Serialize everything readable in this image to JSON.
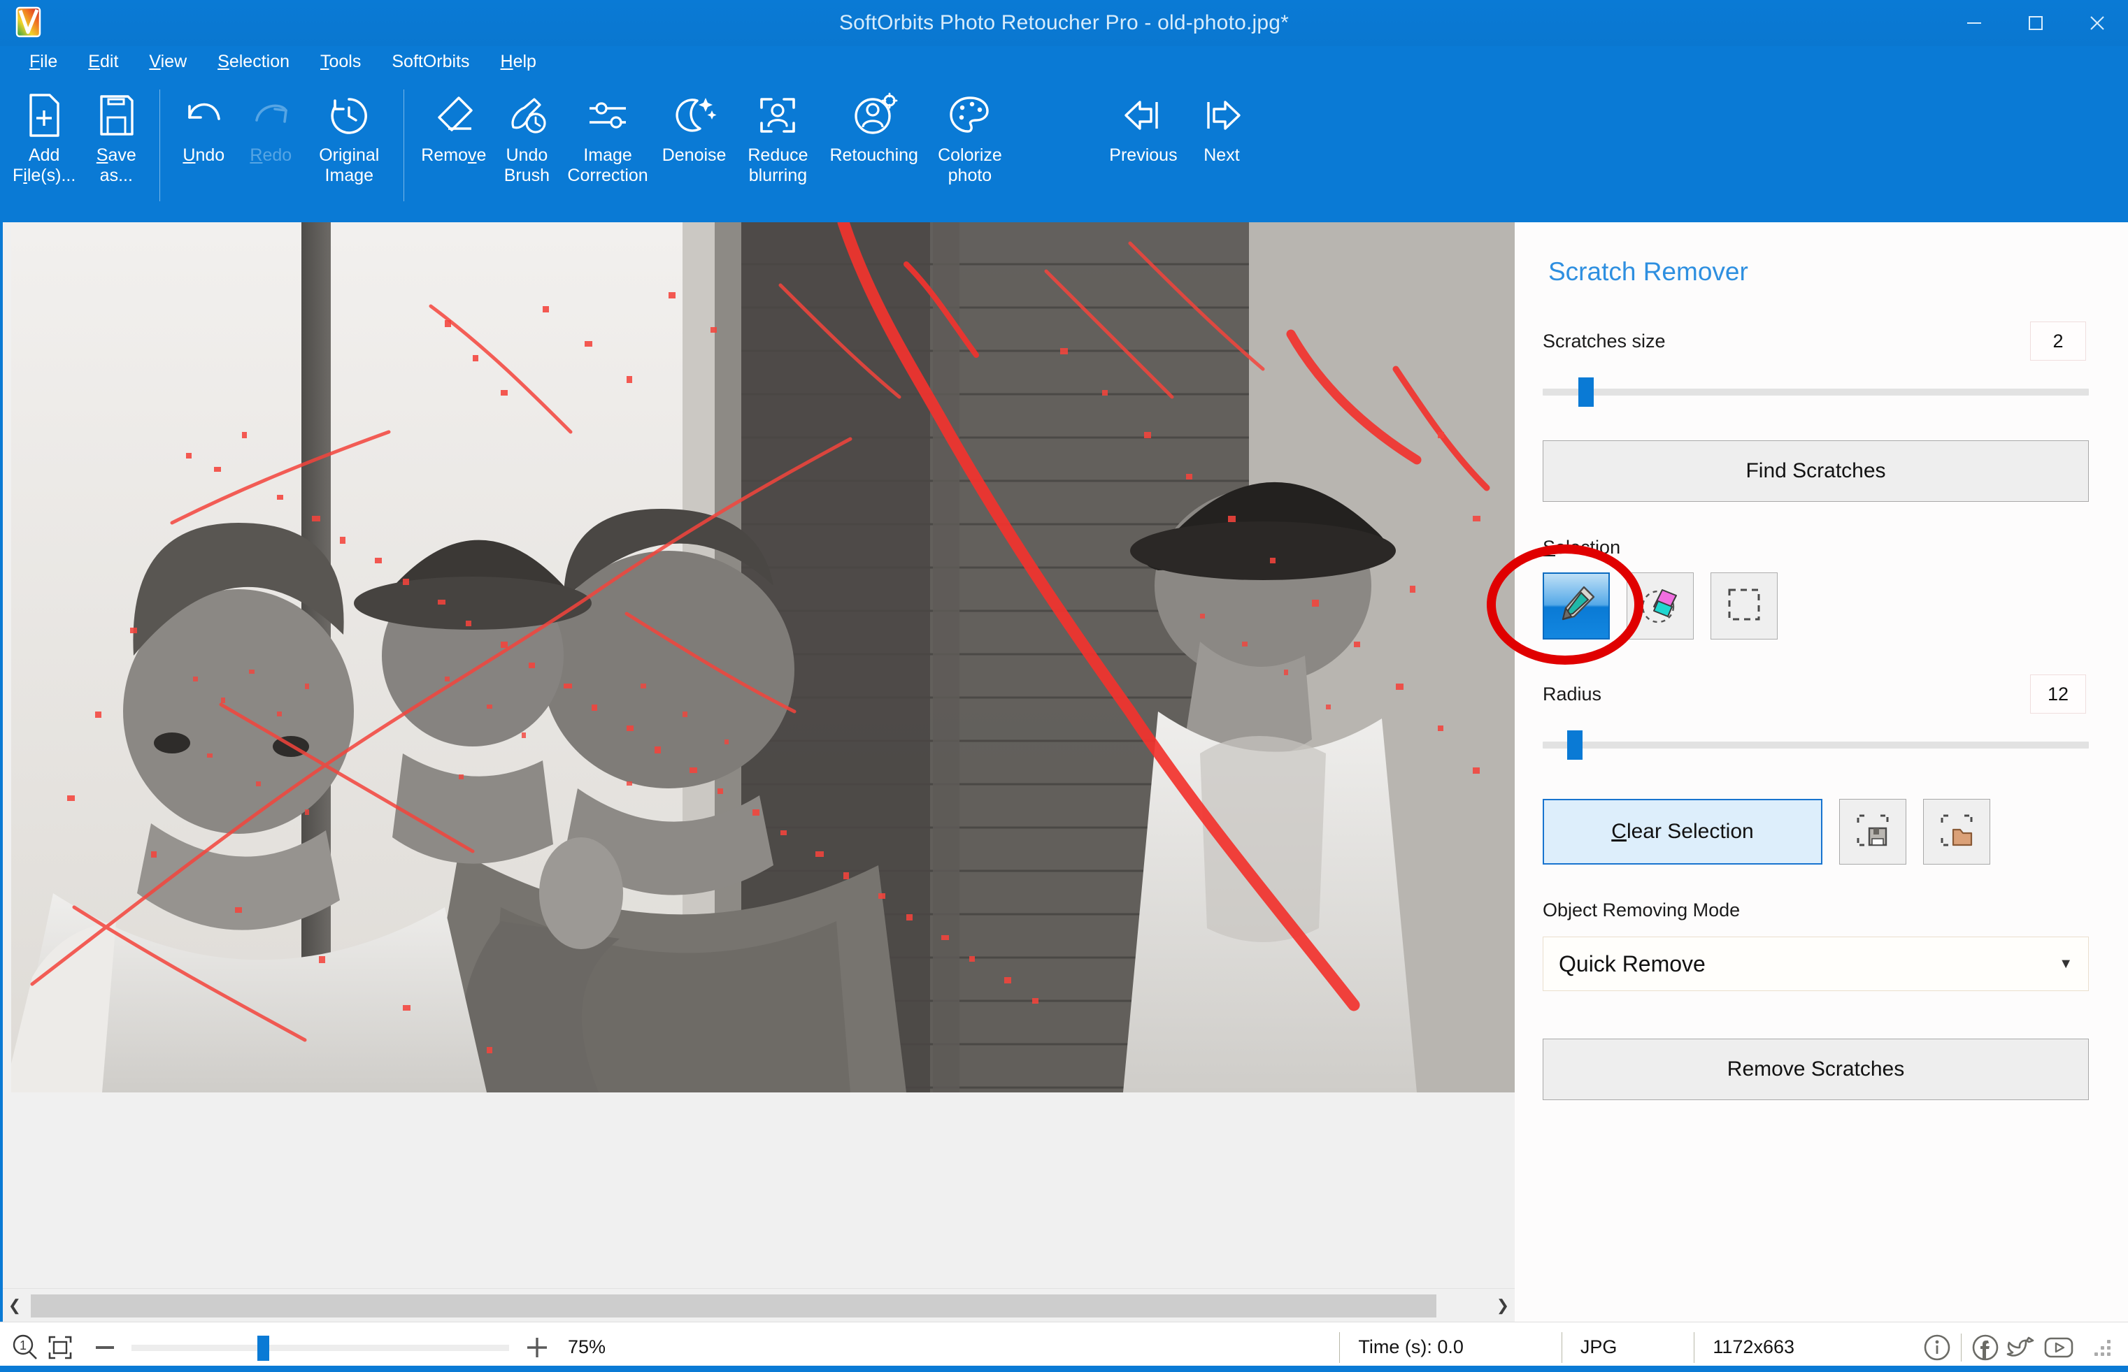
{
  "window": {
    "title": "SoftOrbits Photo Retoucher Pro - old-photo.jpg*",
    "logo_icon": "app-logo-icon",
    "minimize_icon": "minimize-icon",
    "maximize_icon": "maximize-icon",
    "close_icon": "close-icon",
    "accent_color": "#0a7ad5"
  },
  "menubar": {
    "items": [
      {
        "label": "File",
        "mnemonic": "F"
      },
      {
        "label": "Edit",
        "mnemonic": "E"
      },
      {
        "label": "View",
        "mnemonic": "V"
      },
      {
        "label": "Selection",
        "mnemonic": "S"
      },
      {
        "label": "Tools",
        "mnemonic": "T"
      },
      {
        "label": "SoftOrbits",
        "mnemonic": ""
      },
      {
        "label": "Help",
        "mnemonic": "H"
      }
    ]
  },
  "toolbar": {
    "buttons": [
      {
        "label": "Add\nFile(s)...",
        "icon": "add-file-icon",
        "disabled": false
      },
      {
        "label": "Save\nas...",
        "icon": "save-as-icon",
        "disabled": false
      },
      {
        "label": "Undo",
        "icon": "undo-icon",
        "disabled": false
      },
      {
        "label": "Redo",
        "icon": "redo-icon",
        "disabled": true
      },
      {
        "label": "Original\nImage",
        "icon": "original-image-icon",
        "disabled": false
      },
      {
        "label": "Remove",
        "icon": "eraser-icon",
        "disabled": false
      },
      {
        "label": "Undo\nBrush",
        "icon": "undo-brush-icon",
        "disabled": false
      },
      {
        "label": "Image\nCorrection",
        "icon": "sliders-icon",
        "disabled": false
      },
      {
        "label": "Denoise",
        "icon": "moon-sparkle-icon",
        "disabled": false
      },
      {
        "label": "Reduce\nblurring",
        "icon": "focus-person-icon",
        "disabled": false
      },
      {
        "label": "Retouching",
        "icon": "person-gear-icon",
        "disabled": false
      },
      {
        "label": "Colorize\nphoto",
        "icon": "palette-icon",
        "disabled": false
      },
      {
        "label": "Previous",
        "icon": "arrow-left-icon",
        "disabled": false
      },
      {
        "label": "Next",
        "icon": "arrow-right-icon",
        "disabled": false
      }
    ]
  },
  "canvas": {
    "photo_description": "Vintage black-and-white photograph of four people on a porch with red scratch-detection overlay",
    "scroll_left_icon": "chevron-left-icon",
    "scroll_right_icon": "chevron-right-icon"
  },
  "panel": {
    "title": "Scratch Remover",
    "scratches_size": {
      "label": "Scratches size",
      "value": "2",
      "slider_percent": 7
    },
    "find_scratches_label": "Find Scratches",
    "selection": {
      "label": "Selection",
      "mnemonic": "S",
      "tools": [
        {
          "name": "marker-tool",
          "icon": "marker-pen-icon",
          "active": true
        },
        {
          "name": "eraser-tool",
          "icon": "eraser-selection-icon",
          "active": false
        },
        {
          "name": "rectangle-select-tool",
          "icon": "marquee-icon",
          "active": false
        }
      ],
      "highlight": "red-ellipse-annotation"
    },
    "radius": {
      "label": "Radius",
      "value": "12",
      "slider_percent": 5
    },
    "clear_selection_label": "Clear Selection",
    "clear_selection_mnemonic": "C",
    "save_selection_icon": "save-selection-icon",
    "load_selection_icon": "load-selection-icon",
    "object_removing_mode": {
      "label": "Object Removing Mode",
      "value": "Quick Remove",
      "caret_icon": "chevron-down-icon"
    },
    "remove_scratches_label": "Remove Scratches",
    "title_color": "#2e8fe0"
  },
  "statusbar": {
    "zoom_actual_icon": "zoom-actual-size-icon",
    "fit_screen_icon": "fit-to-screen-icon",
    "zoom_out_icon": "minus-icon",
    "zoom_in_icon": "plus-icon",
    "zoom_percent": "75%",
    "zoom_slider_percent": 34,
    "time": "Time (s): 0.0",
    "format": "JPG",
    "dimensions": "1172x663",
    "info_icon": "info-icon",
    "facebook_icon": "facebook-icon",
    "twitter_icon": "twitter-icon",
    "youtube_icon": "youtube-icon",
    "resize_grip_icon": "resize-grip-icon"
  }
}
